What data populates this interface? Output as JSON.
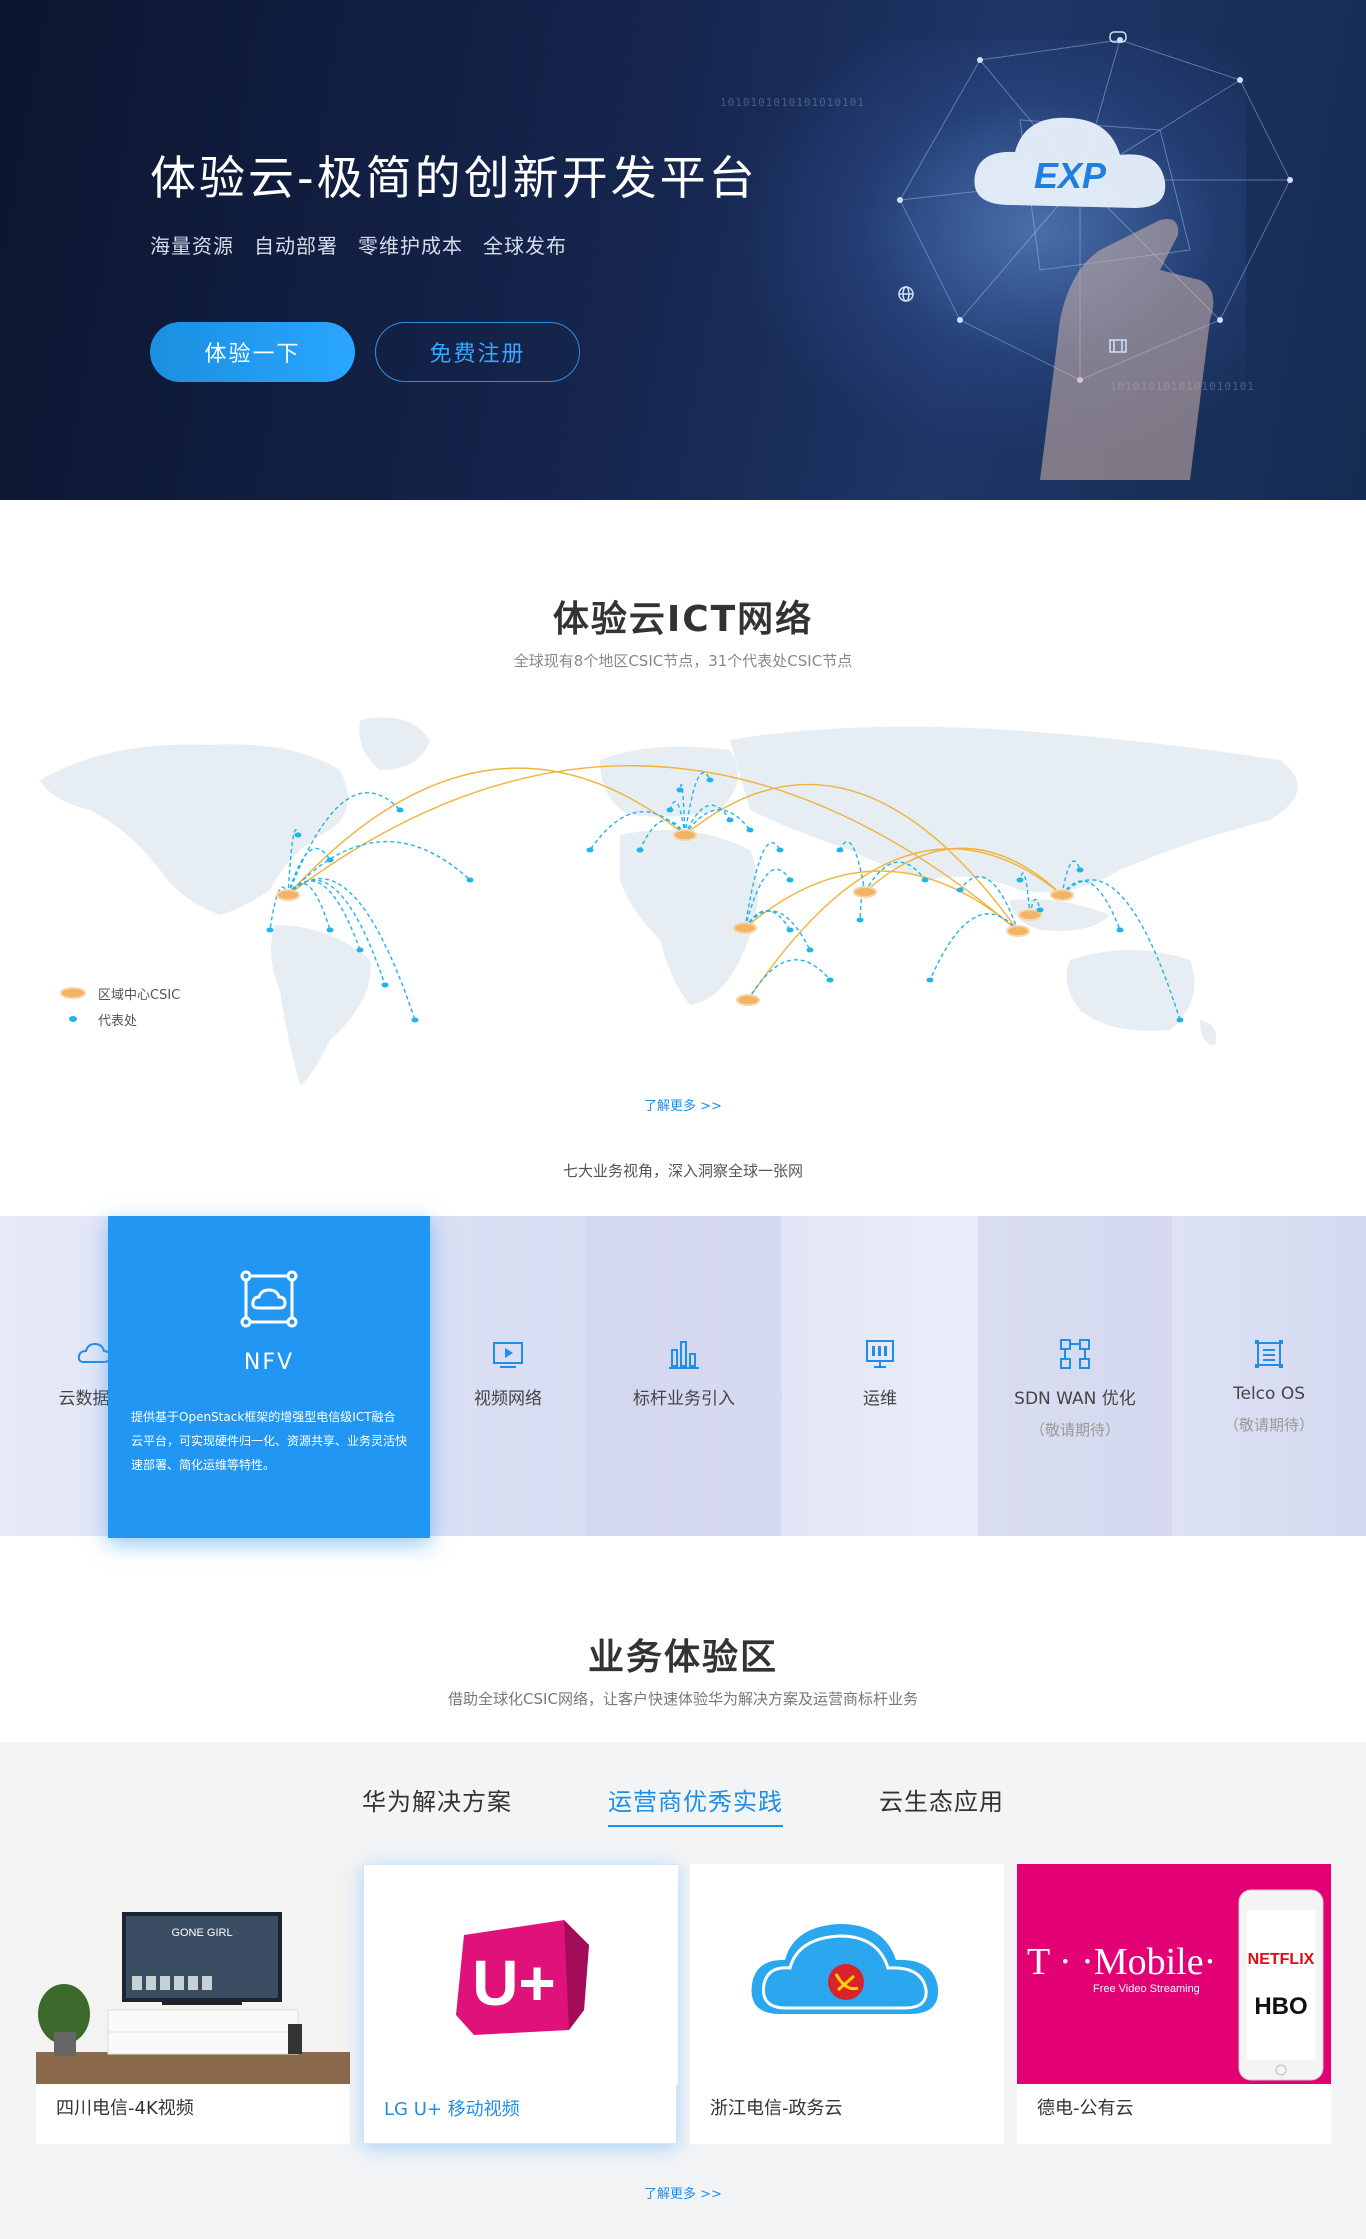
{
  "hero": {
    "title": "体验云-极简的创新开发平台",
    "tags": [
      "海量资源",
      "自动部署",
      "零维护成本",
      "全球发布"
    ],
    "primary_button": "体验一下",
    "secondary_button": "免费注册",
    "logo_text": "EXP",
    "binary_strings": [
      "1010101010101010101",
      "1010101010101010101"
    ]
  },
  "network": {
    "title": "体验云ICT网络",
    "subtitle": "全球现有8个地区CSIC节点，31个代表处CSIC节点",
    "legend": [
      "区域中心CSIC",
      "代表处"
    ],
    "more_link": "了解更多 >>",
    "footer_text": "七大业务视角，深入洞察全球一张网"
  },
  "perspectives": {
    "items": [
      {
        "label": "云数据",
        "icon": "cloud-data-icon",
        "note": ""
      },
      {
        "label": "视频网络",
        "icon": "video-icon",
        "note": ""
      },
      {
        "label": "标杆业务引入",
        "icon": "bar-chart-icon",
        "note": ""
      },
      {
        "label": "运维",
        "icon": "monitor-icon",
        "note": ""
      },
      {
        "label": "SDN WAN 优化",
        "icon": "sdn-icon",
        "note": "（敬请期待）"
      },
      {
        "label": "Telco OS",
        "icon": "telco-icon",
        "note": "（敬请期待）"
      }
    ],
    "active": {
      "title": "NFV",
      "icon": "cloud-frame-icon",
      "description": "提供基于OpenStack框架的增强型电信级ICT融合云平台，可实现硬件归一化、资源共享、业务灵活快速部署、简化运维等特性。"
    }
  },
  "business": {
    "title": "业务体验区",
    "subtitle": "借助全球化CSIC网络，让客户快速体验华为解决方案及运营商标杆业务",
    "tabs": [
      "华为解决方案",
      "运营商优秀实践",
      "云生态应用"
    ],
    "active_tab": 1,
    "cards": [
      {
        "caption": "四川电信-4K视频",
        "tv_text": "GONE GIRL"
      },
      {
        "caption": "LG U+ 移动视频",
        "logo": "U+"
      },
      {
        "caption": "浙江电信-政务云",
        "logo": "cloud-emblem"
      },
      {
        "caption": "德电-公有云",
        "brand": "T · ·Mobile·",
        "brand_sub": "Free Video Streaming",
        "apps": [
          "NETFLIX",
          "HBO"
        ]
      }
    ],
    "more_link": "了解更多 >>"
  },
  "colors": {
    "accent": "#1f8fe6",
    "active_panel": "#2196f3",
    "map_land": "#e6eef4",
    "arc_orange": "#f0b43c",
    "arc_blue": "#1fb4ea"
  }
}
